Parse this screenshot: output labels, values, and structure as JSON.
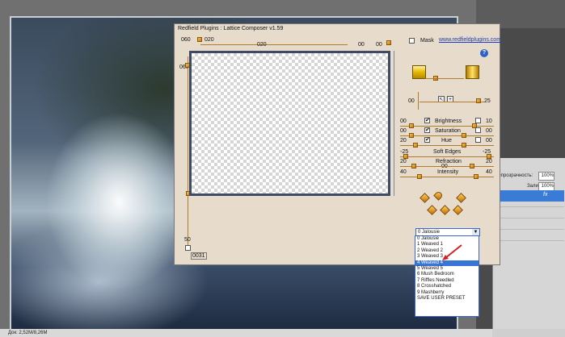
{
  "dialog": {
    "title": "Redfield Plugins : Lattice Composer v1.59",
    "mask_label": "Mask",
    "link": "www.redfieldplugins.com",
    "help": "?",
    "top_values": {
      "left": "060",
      "mid_small": "020",
      "mid": "020",
      "right1": "00",
      "right2": "00"
    },
    "left_values": {
      "top": "060",
      "bottom": "50"
    },
    "bottom_value": "0031",
    "rotate_right": "25",
    "rotate_left": "00",
    "small_buttons": [
      "↖",
      "+"
    ],
    "adjustments": [
      {
        "label": "Brightness",
        "left": "00",
        "right": "10",
        "checked": true
      },
      {
        "label": "Saturation",
        "left": "00",
        "right": "00",
        "checked": true
      },
      {
        "label": "Hue",
        "left": "20",
        "right": "00",
        "checked": true
      }
    ],
    "sliders": [
      {
        "label": "Soft Edges",
        "left": "-25",
        "right": "-25"
      },
      {
        "label": "Refraction",
        "left": "20",
        "right": "20",
        "under": "00"
      },
      {
        "label": "Intensity",
        "left": "40",
        "right": "40"
      }
    ],
    "preset": {
      "selected": "0 Jalousie",
      "options": [
        "0 Jalousie",
        "1 Weaved 1",
        "2 Weaved 2",
        "3 Weaved 3",
        "4 Weaved 4",
        "5 Weaved 5",
        "6 Mush Bedroom",
        "7 Riffles Needled",
        "8 Crosshatched",
        "9 Mashberry",
        "SAVE USER PRESET"
      ],
      "highlighted_index": 4
    }
  },
  "layers_panel": {
    "opacity_label": "Непрозрачность:",
    "opacity_value": "100%",
    "fill_label": "Заливка:",
    "fill_value": "100%",
    "fx_label": "fx"
  },
  "status_bar": {
    "text": "Док: 2,52M/8,26M"
  },
  "colors": {
    "dialog_bg": "#e7dccb",
    "accent": "#b17b2c",
    "selection": "#3875d7"
  }
}
